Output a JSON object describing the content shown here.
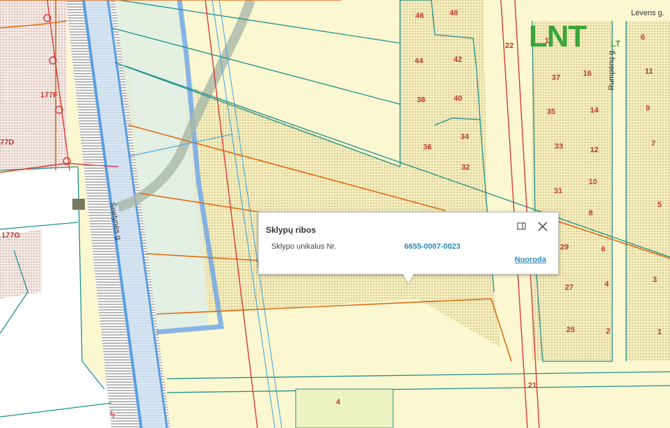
{
  "map": {
    "streets": {
      "left_street": "Šnelynės g.",
      "top_right_street": "Lėvens g.",
      "right_street": "Rumpėnų g."
    },
    "plot_numbers": {
      "left": [
        "177F",
        "77D",
        "177G"
      ],
      "middle": [
        "46",
        "48",
        "44",
        "42",
        "38",
        "40",
        "36",
        "34",
        "32"
      ],
      "right_inner": [
        "12",
        "16",
        "37",
        "35",
        "14",
        "33",
        "12",
        "31",
        "10",
        "8",
        "29",
        "6",
        "27",
        "4",
        "25",
        "2"
      ],
      "right_outer": [
        "6",
        "11",
        "9",
        "7",
        "5",
        "3",
        "1"
      ],
      "misc": [
        "22",
        "21",
        "4"
      ]
    }
  },
  "logo": {
    "text": "LNT",
    "suffix": "LT"
  },
  "popup": {
    "title": "Sklypų ribos",
    "field_label": "Sklypo unikalus Nr.",
    "field_value": "6655-0007-0023",
    "link_label": "Nuoroda",
    "maximize_icon": "maximize-icon",
    "close_icon": "close-icon"
  },
  "colors": {
    "map_background": "#fbf7d0",
    "parcel_line": "#1c8f8f",
    "highlight_line": "#e06a12",
    "road_blue": "#5a9ee0",
    "boundary_red": "#d63a3a",
    "plot_label": "#c0392b",
    "logo_green": "#3aa63a",
    "popup_link": "#2a88b7"
  }
}
